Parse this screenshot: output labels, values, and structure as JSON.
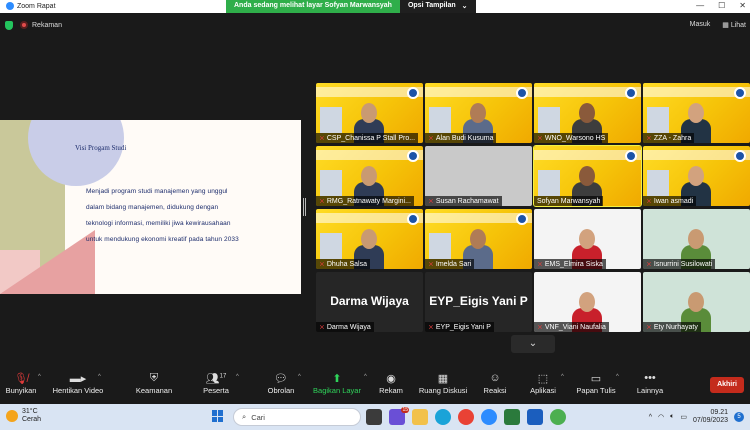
{
  "titlebar": {
    "app_title": "Zoom Rapat",
    "minimize": "—",
    "maximize": "☐",
    "close": "✕"
  },
  "sharebar": {
    "message": "Anda sedang melihat layar Sofyan Marwansyah",
    "options_label": "Opsi Tampilan",
    "options_caret": "⌄"
  },
  "topbar": {
    "recording_label": "Rekaman",
    "sign_in": "Masuk",
    "view": "Lihat"
  },
  "slide": {
    "title": "Visi Progam Studi",
    "body": "Menjadi program studi manajemen yang unggul dalam bidang manajemen, didukung dengan teknologi informasi, memiliki jiwa kewirausahaan untuk mendukung ekonomi kreatif pada tahun 2033"
  },
  "participants": [
    {
      "name": "CSP_Chanissa P Stall Pro...",
      "muted": true,
      "kind": "yellow",
      "active": false
    },
    {
      "name": "Alan Budi Kusuma",
      "muted": true,
      "kind": "yellow",
      "active": false
    },
    {
      "name": "WNO_Warsono HS",
      "muted": true,
      "kind": "yellow",
      "active": false
    },
    {
      "name": "ZZA - Zahra",
      "muted": true,
      "kind": "yellow",
      "active": false
    },
    {
      "name": "RMG_Ratnawaty Margini...",
      "muted": true,
      "kind": "yellow",
      "active": false
    },
    {
      "name": "Susan Rachamawat",
      "muted": true,
      "kind": "gray",
      "active": false
    },
    {
      "name": "Sofyan Marwansyah",
      "muted": false,
      "kind": "yellow",
      "active": true
    },
    {
      "name": "Iwan asmadi",
      "muted": true,
      "kind": "yellow",
      "active": false
    },
    {
      "name": "Dhuha Salsa",
      "muted": true,
      "kind": "yellow",
      "active": false
    },
    {
      "name": "Imelda Sari",
      "muted": true,
      "kind": "yellow",
      "active": false
    },
    {
      "name": "EMS_Elmira Siska",
      "muted": true,
      "kind": "photo",
      "active": false
    },
    {
      "name": "Isnurrini Susilowati",
      "muted": true,
      "kind": "photo",
      "active": false
    },
    {
      "name": "Darma Wijaya",
      "muted": true,
      "kind": "text",
      "big": "Darma Wijaya",
      "active": false
    },
    {
      "name": "EYP_Eigis Yani P",
      "muted": true,
      "kind": "text",
      "big": "EYP_Eigis Yani P",
      "active": false
    },
    {
      "name": "VNF_Viani Naufalia",
      "muted": true,
      "kind": "photo",
      "active": false
    },
    {
      "name": "Ety Nurhayaty",
      "muted": true,
      "kind": "photo",
      "active": false
    }
  ],
  "gallery_more": "⌄",
  "toolbar": {
    "unmute": "Bunyikan",
    "stop_video": "Hentikan Video",
    "security": "Keamanan",
    "participants": "Peserta",
    "participants_count": "17",
    "chat": "Obrolan",
    "share_screen": "Bagikan Layar",
    "record": "Rekam",
    "breakout": "Ruang Diskusi",
    "reactions": "Reaksi",
    "apps": "Aplikasi",
    "whiteboard": "Papan Tulis",
    "more": "Lainnya",
    "end": "Akhiri"
  },
  "taskbar": {
    "temperature": "31°C",
    "weather": "Cerah",
    "search_placeholder": "Cari",
    "time": "09.21",
    "date": "07/09/2023",
    "notif_count": "5",
    "teams_badge": "15"
  }
}
